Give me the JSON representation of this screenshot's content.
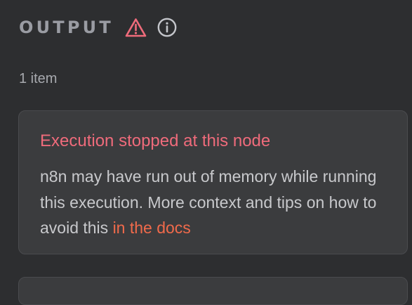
{
  "header": {
    "title": "OUTPUT",
    "icons": [
      "warning-icon",
      "info-icon"
    ]
  },
  "item_count": "1 item",
  "error_card": {
    "title": "Execution stopped at this node",
    "message": "n8n may have run out of memory while running this execution. More context and tips on how to avoid this",
    "link_text": "in the docs"
  },
  "colors": {
    "background": "#2d2e30",
    "card": "#3b3c3e",
    "error": "#ef6b7b",
    "link": "#f06a4b",
    "muted": "#9a9ca3"
  }
}
